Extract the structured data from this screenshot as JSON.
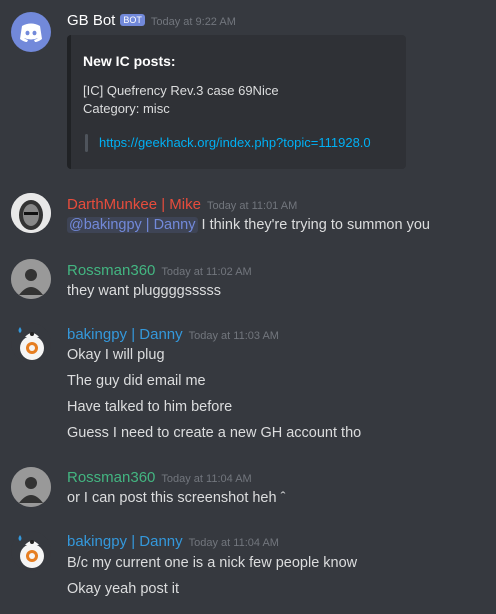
{
  "colors": {
    "background": "#36393f",
    "bot_name": "#ffffff",
    "darth": "#e74c3c",
    "ross": "#43b581",
    "baking": "#3498db",
    "link": "#00b0f4"
  },
  "bot_message": {
    "author": "GB Bot",
    "tag": "BOT",
    "time": "Today at 9:22 AM",
    "embed": {
      "title": "New IC posts:",
      "line1": "[IC] Quefrency Rev.3 case 69Nice",
      "line2": "Category: misc",
      "link": "https://geekhack.org/index.php?topic=111928.0"
    }
  },
  "messages": [
    {
      "author": "DarthMunkee | Mike",
      "time": "Today at 11:01 AM",
      "mention": "@bakingpy | Danny",
      "text": "I think they're trying to summon you"
    },
    {
      "author": "Rossman360",
      "time": "Today at 11:02 AM",
      "text": "they want pluggggsssss"
    },
    {
      "author": "bakingpy | Danny",
      "time": "Today at 11:03 AM",
      "lines": [
        "Okay I will plug",
        "The guy did email me",
        "Have talked to him before",
        "Guess I need to create a new GH account tho"
      ]
    },
    {
      "author": "Rossman360",
      "time": "Today at 11:04 AM",
      "text": "or I can post this screenshot heh ˆ"
    },
    {
      "author": "bakingpy | Danny",
      "time": "Today at 11:04 AM",
      "lines": [
        "B/c my current one is a nick few people know",
        "Okay yeah post it"
      ]
    }
  ]
}
